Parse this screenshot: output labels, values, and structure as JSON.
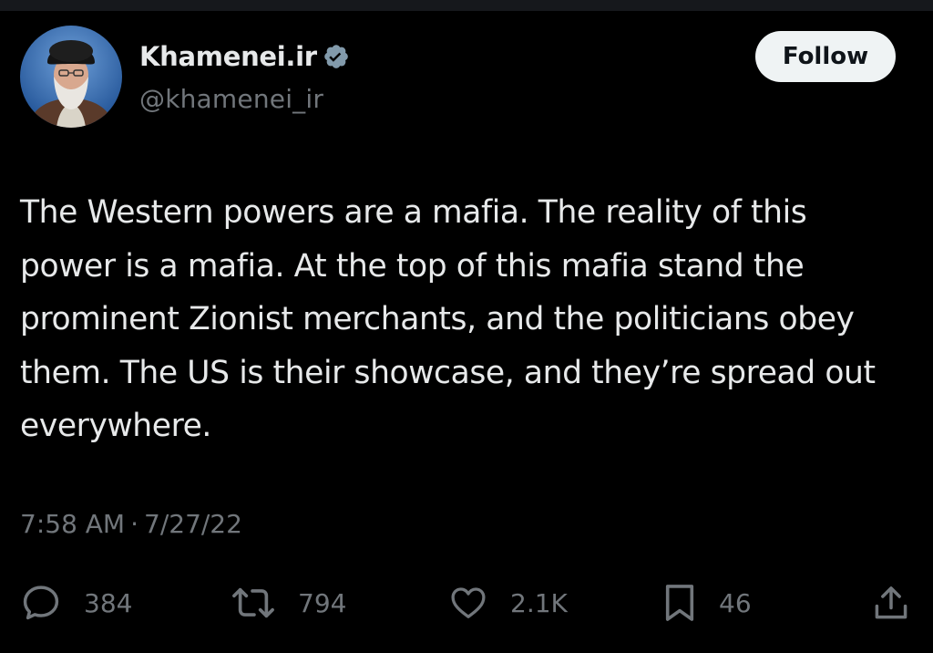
{
  "author": {
    "display_name": "Khamenei.ir",
    "handle": "@khamenei_ir",
    "verified": true,
    "avatar_icon": "profile-photo"
  },
  "follow_button": {
    "label": "Follow"
  },
  "tweet": {
    "text": "The Western powers are a mafia. The reality of this power is a mafia. At the top of this mafia stand the prominent Zionist merchants, and the politicians obey them. The US is their showcase, and they’re spread out everywhere.",
    "time": "7:58 AM",
    "separator": "·",
    "date": "7/27/22"
  },
  "actions": {
    "replies": "384",
    "reposts": "794",
    "likes": "2.1K",
    "bookmarks": "46"
  },
  "colors": {
    "background": "#000000",
    "text_primary": "#e7e9ea",
    "text_secondary": "#71767b",
    "verified_badge": "#829aab",
    "follow_bg": "#eff3f4"
  }
}
